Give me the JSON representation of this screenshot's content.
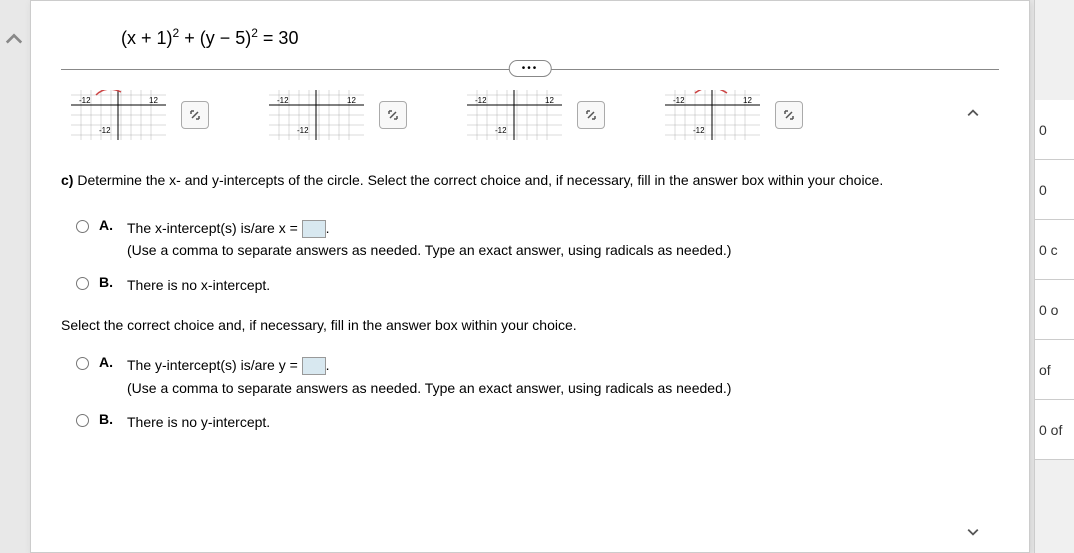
{
  "equation": {
    "part1": "(x + 1)",
    "exp1": "2",
    "part2": " + (y − 5)",
    "exp2": "2",
    "part3": " = 30"
  },
  "ellipsis": "•••",
  "graphs": {
    "labels": {
      "neg": "-12",
      "pos": "12",
      "bottom": "-12"
    }
  },
  "question_c": {
    "label": "c)",
    "text": "Determine the x- and y-intercepts of the circle. Select the correct choice and, if necessary, fill in the answer box within your choice."
  },
  "x_intercept": {
    "choice_a": {
      "label": "A.",
      "text_before": "The x-intercept(s) is/are x = ",
      "text_after": ".",
      "hint": "(Use a comma to separate answers as needed. Type an exact answer, using radicals as needed.)"
    },
    "choice_b": {
      "label": "B.",
      "text": "There is no x-intercept."
    }
  },
  "instruction2": "Select the correct choice and, if necessary, fill in the answer box within your choice.",
  "y_intercept": {
    "choice_a": {
      "label": "A.",
      "text_before": "The y-intercept(s) is/are y = ",
      "text_after": ".",
      "hint": "(Use a comma to separate answers as needed. Type an exact answer, using radicals as needed.)"
    },
    "choice_b": {
      "label": "B.",
      "text": "There is no y-intercept."
    }
  },
  "right_panel": {
    "items": [
      "0",
      "0",
      "0 c",
      "0 o",
      "of",
      "0 of"
    ]
  }
}
